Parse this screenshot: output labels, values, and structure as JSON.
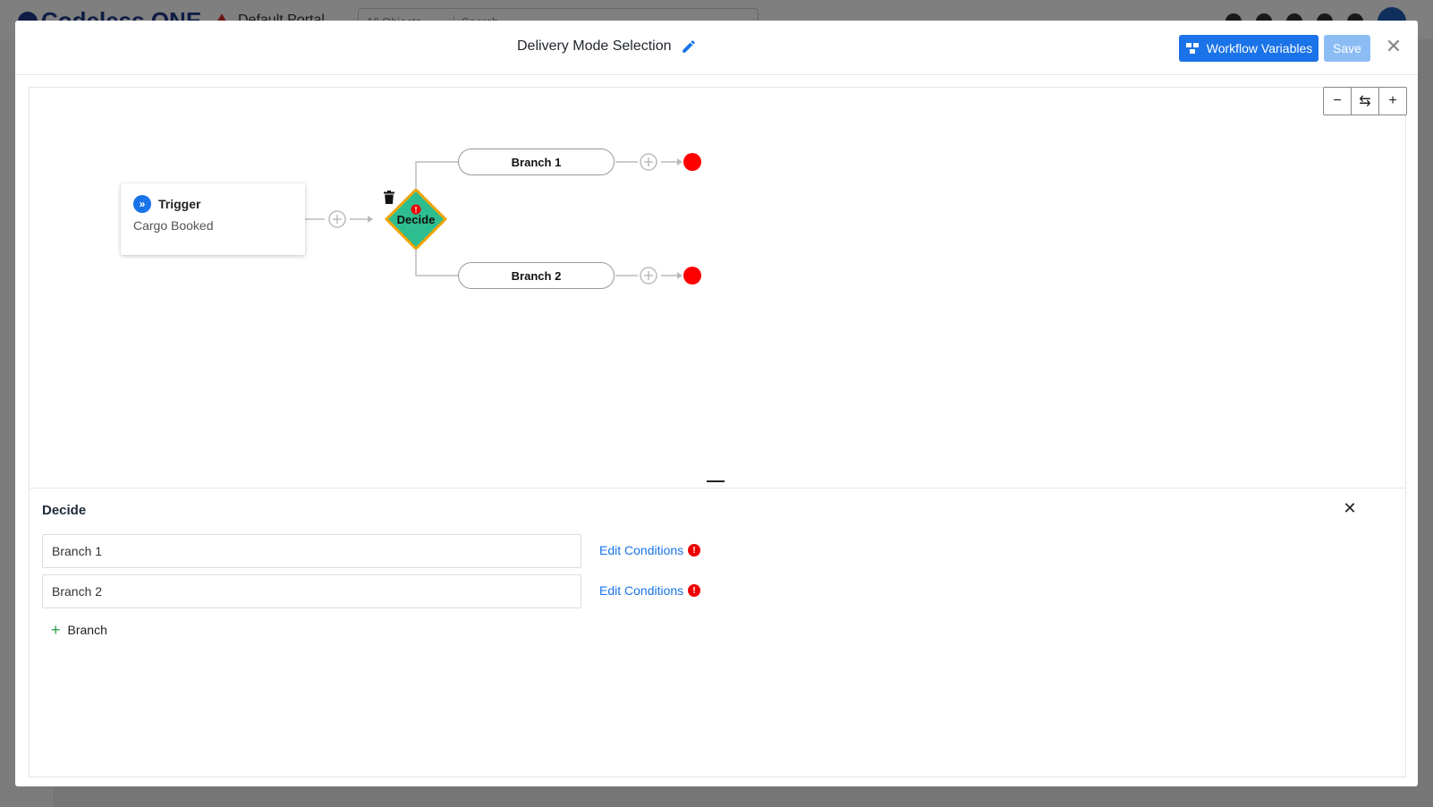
{
  "background_app": {
    "logo_text": "Codeless ONE",
    "portal_name": "Default Portal",
    "object_filter": "All Objects",
    "search_placeholder": "Search"
  },
  "modal": {
    "title": "Delivery Mode Selection",
    "workflow_variables_label": "Workflow Variables",
    "save_label": "Save",
    "close_glyph": "✕"
  },
  "canvas": {
    "zoom_out_glyph": "−",
    "reset_glyph": "⇆",
    "zoom_in_glyph": "+",
    "trigger": {
      "title": "Trigger",
      "subtitle": "Cargo Booked"
    },
    "decision": {
      "label": "Decide",
      "warning_glyph": "!"
    },
    "branches": [
      {
        "label": "Branch 1"
      },
      {
        "label": "Branch 2"
      }
    ],
    "colors": {
      "decision_fill": "#2ebd8f",
      "decision_border": "#f0a500",
      "end_node": "#ff0000",
      "accent": "#1a73e8"
    }
  },
  "panel": {
    "title": "Decide",
    "close_glyph": "✕",
    "branches": [
      {
        "name": "Branch 1",
        "edit_label": "Edit Conditions",
        "warning_glyph": "!"
      },
      {
        "name": "Branch 2",
        "edit_label": "Edit Conditions",
        "warning_glyph": "!"
      }
    ],
    "add_branch_label": "Branch",
    "add_glyph": "+"
  }
}
